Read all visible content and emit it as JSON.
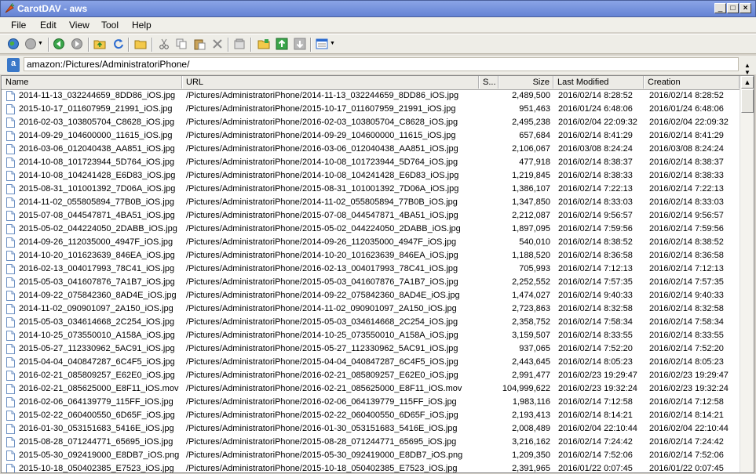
{
  "window": {
    "title": "CarotDAV - aws"
  },
  "menu": [
    "File",
    "Edit",
    "View",
    "Tool",
    "Help"
  ],
  "address": {
    "value": "amazon:/Pictures/AdministratoriPhone/"
  },
  "columns": {
    "name": "Name",
    "url": "URL",
    "s": "S...",
    "size": "Size",
    "modified": "Last Modified",
    "creation": "Creation"
  },
  "files": [
    {
      "name": "2014-11-13_032244659_8DD86_iOS.jpg",
      "url": "/Pictures/AdministratoriPhone/2014-11-13_032244659_8DD86_iOS.jpg",
      "size": "2,489,500",
      "modified": "2016/02/14 8:28:52",
      "created": "2016/02/14 8:28:52"
    },
    {
      "name": "2015-10-17_011607959_21991_iOS.jpg",
      "url": "/Pictures/AdministratoriPhone/2015-10-17_011607959_21991_iOS.jpg",
      "size": "951,463",
      "modified": "2016/01/24 6:48:06",
      "created": "2016/01/24 6:48:06"
    },
    {
      "name": "2016-02-03_103805704_C8628_iOS.jpg",
      "url": "/Pictures/AdministratoriPhone/2016-02-03_103805704_C8628_iOS.jpg",
      "size": "2,495,238",
      "modified": "2016/02/04 22:09:32",
      "created": "2016/02/04 22:09:32"
    },
    {
      "name": "2014-09-29_104600000_11615_iOS.jpg",
      "url": "/Pictures/AdministratoriPhone/2014-09-29_104600000_11615_iOS.jpg",
      "size": "657,684",
      "modified": "2016/02/14 8:41:29",
      "created": "2016/02/14 8:41:29"
    },
    {
      "name": "2016-03-06_012040438_AA851_iOS.jpg",
      "url": "/Pictures/AdministratoriPhone/2016-03-06_012040438_AA851_iOS.jpg",
      "size": "2,106,067",
      "modified": "2016/03/08 8:24:24",
      "created": "2016/03/08 8:24:24"
    },
    {
      "name": "2014-10-08_101723944_5D764_iOS.jpg",
      "url": "/Pictures/AdministratoriPhone/2014-10-08_101723944_5D764_iOS.jpg",
      "size": "477,918",
      "modified": "2016/02/14 8:38:37",
      "created": "2016/02/14 8:38:37"
    },
    {
      "name": "2014-10-08_104241428_E6D83_iOS.jpg",
      "url": "/Pictures/AdministratoriPhone/2014-10-08_104241428_E6D83_iOS.jpg",
      "size": "1,219,845",
      "modified": "2016/02/14 8:38:33",
      "created": "2016/02/14 8:38:33"
    },
    {
      "name": "2015-08-31_101001392_7D06A_iOS.jpg",
      "url": "/Pictures/AdministratoriPhone/2015-08-31_101001392_7D06A_iOS.jpg",
      "size": "1,386,107",
      "modified": "2016/02/14 7:22:13",
      "created": "2016/02/14 7:22:13"
    },
    {
      "name": "2014-11-02_055805894_77B0B_iOS.jpg",
      "url": "/Pictures/AdministratoriPhone/2014-11-02_055805894_77B0B_iOS.jpg",
      "size": "1,347,850",
      "modified": "2016/02/14 8:33:03",
      "created": "2016/02/14 8:33:03"
    },
    {
      "name": "2015-07-08_044547871_4BA51_iOS.jpg",
      "url": "/Pictures/AdministratoriPhone/2015-07-08_044547871_4BA51_iOS.jpg",
      "size": "2,212,087",
      "modified": "2016/02/14 9:56:57",
      "created": "2016/02/14 9:56:57"
    },
    {
      "name": "2015-05-02_044224050_2DABB_iOS.jpg",
      "url": "/Pictures/AdministratoriPhone/2015-05-02_044224050_2DABB_iOS.jpg",
      "size": "1,897,095",
      "modified": "2016/02/14 7:59:56",
      "created": "2016/02/14 7:59:56"
    },
    {
      "name": "2014-09-26_112035000_4947F_iOS.jpg",
      "url": "/Pictures/AdministratoriPhone/2014-09-26_112035000_4947F_iOS.jpg",
      "size": "540,010",
      "modified": "2016/02/14 8:38:52",
      "created": "2016/02/14 8:38:52"
    },
    {
      "name": "2014-10-20_101623639_846EA_iOS.jpg",
      "url": "/Pictures/AdministratoriPhone/2014-10-20_101623639_846EA_iOS.jpg",
      "size": "1,188,520",
      "modified": "2016/02/14 8:36:58",
      "created": "2016/02/14 8:36:58"
    },
    {
      "name": "2016-02-13_004017993_78C41_iOS.jpg",
      "url": "/Pictures/AdministratoriPhone/2016-02-13_004017993_78C41_iOS.jpg",
      "size": "705,993",
      "modified": "2016/02/14 7:12:13",
      "created": "2016/02/14 7:12:13"
    },
    {
      "name": "2015-05-03_041607876_7A1B7_iOS.jpg",
      "url": "/Pictures/AdministratoriPhone/2015-05-03_041607876_7A1B7_iOS.jpg",
      "size": "2,252,552",
      "modified": "2016/02/14 7:57:35",
      "created": "2016/02/14 7:57:35"
    },
    {
      "name": "2014-09-22_075842360_8AD4E_iOS.jpg",
      "url": "/Pictures/AdministratoriPhone/2014-09-22_075842360_8AD4E_iOS.jpg",
      "size": "1,474,027",
      "modified": "2016/02/14 9:40:33",
      "created": "2016/02/14 9:40:33"
    },
    {
      "name": "2014-11-02_090901097_2A150_iOS.jpg",
      "url": "/Pictures/AdministratoriPhone/2014-11-02_090901097_2A150_iOS.jpg",
      "size": "2,723,863",
      "modified": "2016/02/14 8:32:58",
      "created": "2016/02/14 8:32:58"
    },
    {
      "name": "2015-05-03_034614668_2C254_iOS.jpg",
      "url": "/Pictures/AdministratoriPhone/2015-05-03_034614668_2C254_iOS.jpg",
      "size": "2,358,752",
      "modified": "2016/02/14 7:58:34",
      "created": "2016/02/14 7:58:34"
    },
    {
      "name": "2014-10-25_073550010_A158A_iOS.jpg",
      "url": "/Pictures/AdministratoriPhone/2014-10-25_073550010_A158A_iOS.jpg",
      "size": "3,159,507",
      "modified": "2016/02/14 8:33:55",
      "created": "2016/02/14 8:33:55"
    },
    {
      "name": "2015-05-27_112330962_5AC91_iOS.jpg",
      "url": "/Pictures/AdministratoriPhone/2015-05-27_112330962_5AC91_iOS.jpg",
      "size": "937,065",
      "modified": "2016/02/14 7:52:20",
      "created": "2016/02/14 7:52:20"
    },
    {
      "name": "2015-04-04_040847287_6C4F5_iOS.jpg",
      "url": "/Pictures/AdministratoriPhone/2015-04-04_040847287_6C4F5_iOS.jpg",
      "size": "2,443,645",
      "modified": "2016/02/14 8:05:23",
      "created": "2016/02/14 8:05:23"
    },
    {
      "name": "2016-02-21_085809257_E62E0_iOS.jpg",
      "url": "/Pictures/AdministratoriPhone/2016-02-21_085809257_E62E0_iOS.jpg",
      "size": "2,991,477",
      "modified": "2016/02/23 19:29:47",
      "created": "2016/02/23 19:29:47"
    },
    {
      "name": "2016-02-21_085625000_E8F11_iOS.mov",
      "url": "/Pictures/AdministratoriPhone/2016-02-21_085625000_E8F11_iOS.mov",
      "size": "104,999,622",
      "modified": "2016/02/23 19:32:24",
      "created": "2016/02/23 19:32:24"
    },
    {
      "name": "2016-02-06_064139779_115FF_iOS.jpg",
      "url": "/Pictures/AdministratoriPhone/2016-02-06_064139779_115FF_iOS.jpg",
      "size": "1,983,116",
      "modified": "2016/02/14 7:12:58",
      "created": "2016/02/14 7:12:58"
    },
    {
      "name": "2015-02-22_060400550_6D65F_iOS.jpg",
      "url": "/Pictures/AdministratoriPhone/2015-02-22_060400550_6D65F_iOS.jpg",
      "size": "2,193,413",
      "modified": "2016/02/14 8:14:21",
      "created": "2016/02/14 8:14:21"
    },
    {
      "name": "2016-01-30_053151683_5416E_iOS.jpg",
      "url": "/Pictures/AdministratoriPhone/2016-01-30_053151683_5416E_iOS.jpg",
      "size": "2,008,489",
      "modified": "2016/02/04 22:10:44",
      "created": "2016/02/04 22:10:44"
    },
    {
      "name": "2015-08-28_071244771_65695_iOS.jpg",
      "url": "/Pictures/AdministratoriPhone/2015-08-28_071244771_65695_iOS.jpg",
      "size": "3,216,162",
      "modified": "2016/02/14 7:24:42",
      "created": "2016/02/14 7:24:42"
    },
    {
      "name": "2015-05-30_092419000_E8DB7_iOS.png",
      "url": "/Pictures/AdministratoriPhone/2015-05-30_092419000_E8DB7_iOS.png",
      "size": "1,209,350",
      "modified": "2016/02/14 7:52:06",
      "created": "2016/02/14 7:52:06"
    },
    {
      "name": "2015-10-18_050402385_E7523_iOS.jpg",
      "url": "/Pictures/AdministratoriPhone/2015-10-18_050402385_E7523_iOS.jpg",
      "size": "2,391,965",
      "modified": "2016/01/22 0:07:45",
      "created": "2016/01/22 0:07:45"
    }
  ]
}
